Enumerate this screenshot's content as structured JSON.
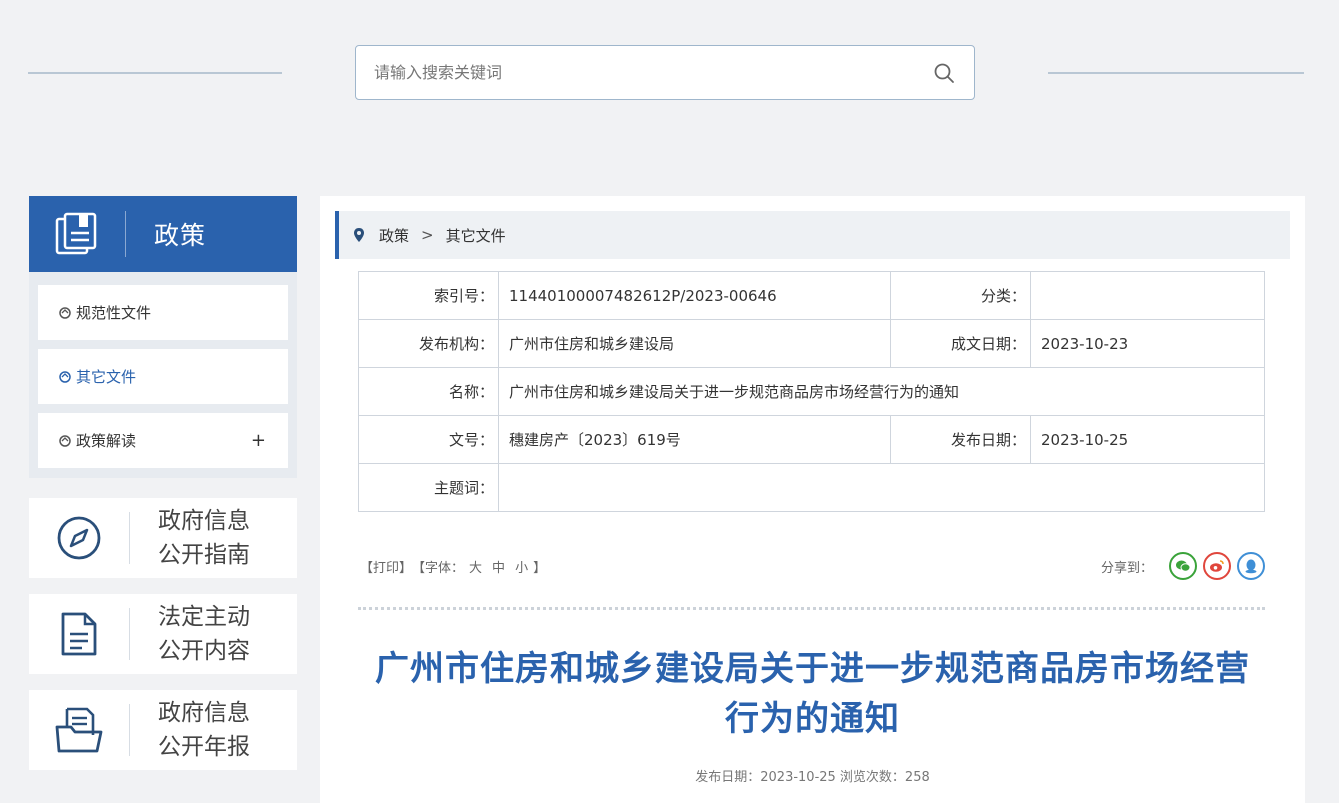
{
  "search": {
    "placeholder": "请输入搜索关键词"
  },
  "sidebar": {
    "header_title": "政策",
    "items": [
      {
        "label": "规范性文件",
        "active": false
      },
      {
        "label": "其它文件",
        "active": true
      },
      {
        "label": "政策解读",
        "expand": "+"
      }
    ],
    "cards": [
      {
        "line1": "政府信息",
        "line2": "公开指南",
        "icon": "compass-icon"
      },
      {
        "line1": "法定主动",
        "line2": "公开内容",
        "icon": "document-icon"
      },
      {
        "line1": "政府信息",
        "line2": "公开年报",
        "icon": "folder-report-icon"
      }
    ]
  },
  "breadcrumb": {
    "level1": "政策",
    "separator": ">",
    "level2": "其它文件"
  },
  "meta": {
    "index_label": "索引号：",
    "index_value": "11440100007482612P/2023-00646",
    "category_label": "分类：",
    "category_value": "",
    "issuer_label": "发布机构：",
    "issuer_value": "广州市住房和城乡建设局",
    "written_label": "成文日期：",
    "written_value": "2023-10-23",
    "name_label": "名称：",
    "name_value": "广州市住房和城乡建设局关于进一步规范商品房市场经营行为的通知",
    "docno_label": "文号：",
    "docno_value": "穗建房产〔2023〕619号",
    "publish_label": "发布日期：",
    "publish_value": "2023-10-25",
    "subject_label": "主题词：",
    "subject_value": ""
  },
  "tools": {
    "print": "【打印】",
    "font_prefix": "【字体：",
    "font_large": "大",
    "font_medium": "中",
    "font_small": "小",
    "font_suffix": "】",
    "share_label": "分享到："
  },
  "article": {
    "title_line1": "广州市住房和城乡建设局关于进一步规范商品房市场经营",
    "title_line2": "行为的通知",
    "pub_info": "发布日期：2023-10-25  浏览次数：258"
  },
  "colors": {
    "brand": "#2a62ad",
    "wechat": "#3aa33a",
    "weibo": "#e0463c",
    "qq": "#3f8fd6"
  }
}
